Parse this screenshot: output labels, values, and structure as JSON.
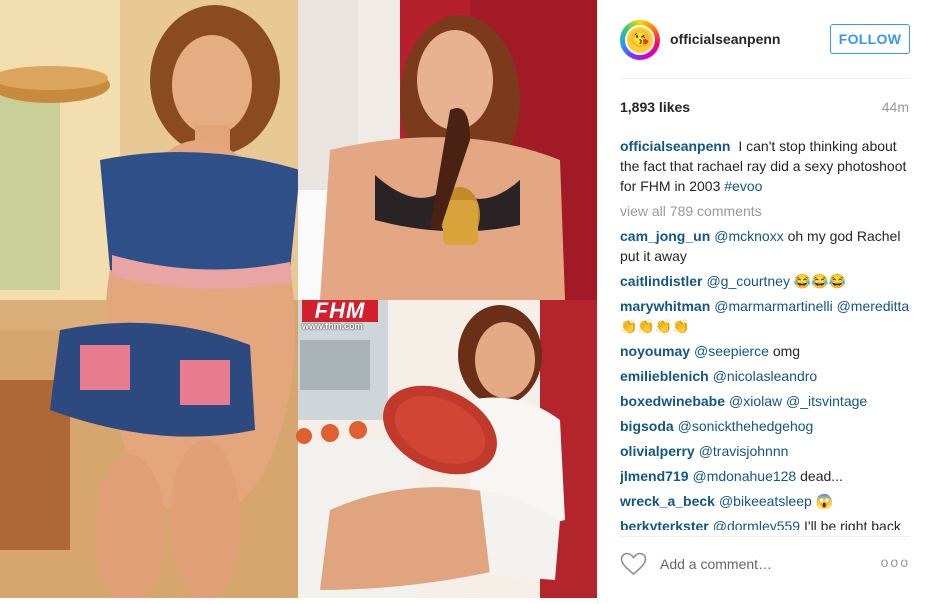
{
  "post": {
    "username": "officialseanpenn",
    "follow_label": "FOLLOW",
    "likes": "1,893 likes",
    "time": "44m",
    "caption_user": "officialseanpenn",
    "caption_text": "I can't stop thinking about the fact that rachael ray did a sexy photoshoot for FHM in 2003",
    "caption_tag": "#evoo",
    "view_all": "view all 789 comments",
    "add_comment_placeholder": "Add a comment…",
    "more_label": "ooo"
  },
  "photo": {
    "magazine_logo": "FHM",
    "magazine_url": "www.fhm.com"
  },
  "comments": [
    {
      "user": "cam_jong_un",
      "mention": "@mcknoxx",
      "text": "oh my god Rachel put it away"
    },
    {
      "user": "caitlindistler",
      "mention": "@g_courtney",
      "text": "😂😂😂"
    },
    {
      "user": "marywhitman",
      "mention": "@marmarmartinelli @mereditta",
      "text": "👏👏👏👏"
    },
    {
      "user": "noyoumay",
      "mention": "@seepierce",
      "text": "omg"
    },
    {
      "user": "emilieblenich",
      "mention": "@nicolasleandro",
      "text": ""
    },
    {
      "user": "boxedwinebabe",
      "mention": "@xiolaw @_itsvintage",
      "text": ""
    },
    {
      "user": "bigsoda",
      "mention": "@sonickthehedgehog",
      "text": ""
    },
    {
      "user": "olivialperry",
      "mention": "@travisjohnnn",
      "text": ""
    },
    {
      "user": "jlmend719",
      "mention": "@mdonahue128",
      "text": "dead..."
    },
    {
      "user": "wreck_a_beck",
      "mention": "@bikeeatsleep",
      "text": "😱"
    },
    {
      "user": "berkyterkster",
      "mention": "@dormley559",
      "text": "I'll be right back"
    }
  ],
  "colors": {
    "link": "#125688",
    "follow_blue": "#3897f0",
    "muted": "#999999"
  }
}
